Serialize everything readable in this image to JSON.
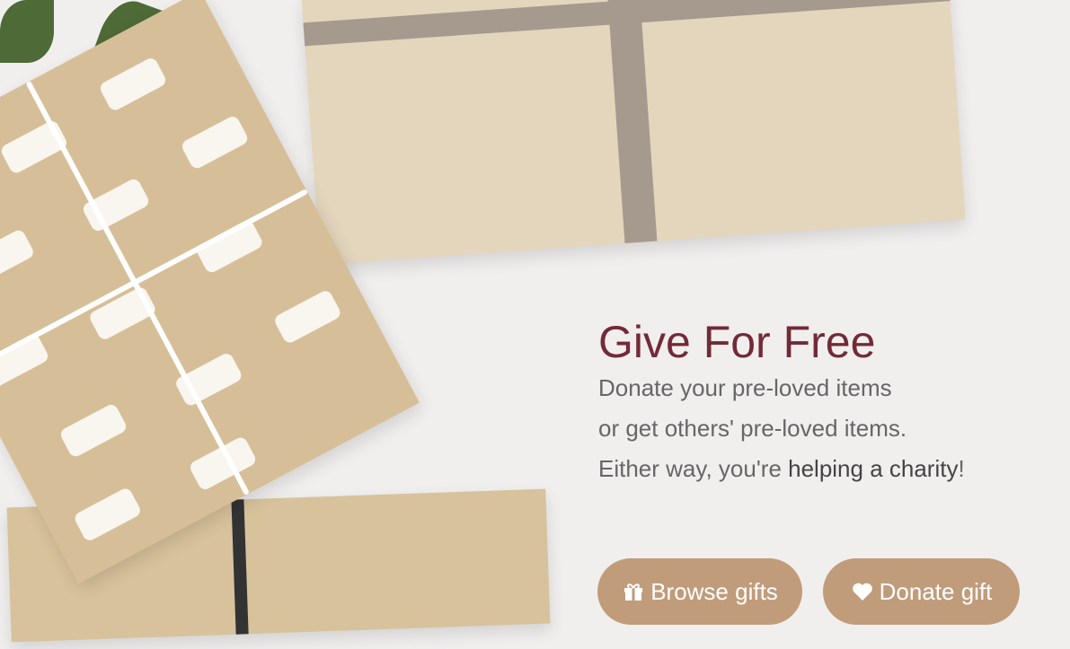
{
  "hero": {
    "title": "Give For Free",
    "line1": "Donate your pre-loved items",
    "line2": "or get others' pre-loved items.",
    "line3_prefix": "Either way, you're ",
    "line3_bold": "helping a charity",
    "line3_suffix": "!"
  },
  "buttons": {
    "browse": {
      "label": "Browse gifts",
      "icon": "gift-icon"
    },
    "donate": {
      "label": "Donate gift",
      "icon": "heart-icon"
    }
  },
  "colors": {
    "title": "#722b36",
    "button": "#c09c7b",
    "text": "#666666"
  }
}
